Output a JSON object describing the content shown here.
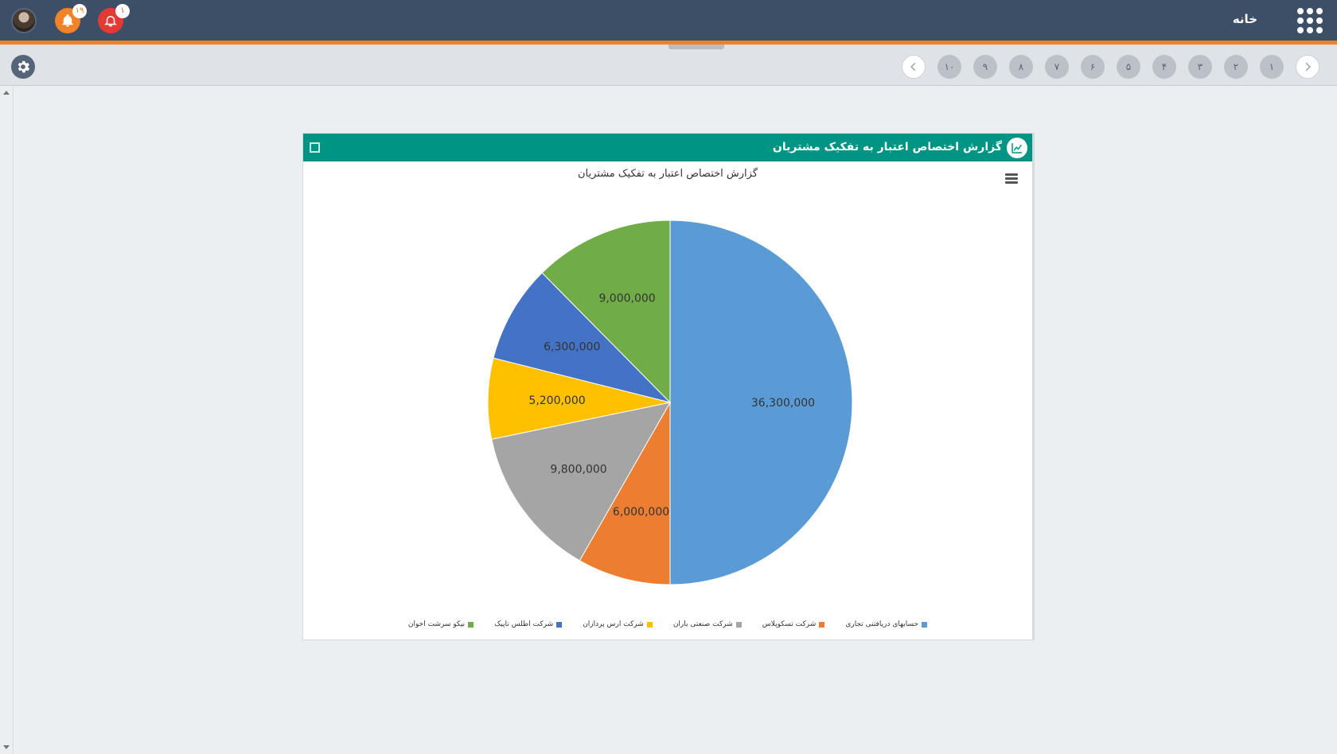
{
  "topbar": {
    "home_label": "خانه",
    "notifications": {
      "count": "۱۹"
    },
    "alerts": {
      "count": "۱"
    }
  },
  "tabs": {
    "pages": [
      "۱",
      "۲",
      "۳",
      "۴",
      "۵",
      "۶",
      "۷",
      "۸",
      "۹",
      "۱۰"
    ]
  },
  "panel": {
    "title": "گزارش اختصاص اعتبار به تفکیک مشتریان"
  },
  "chart_data": {
    "type": "pie",
    "title": "گزارش اختصاص اعتبار به تفکیک مشتریان",
    "legend_placement": "bottom",
    "slices": [
      {
        "name": "حسابهای دریافتنی تجاری",
        "value": 36300000,
        "label": "36,300,000",
        "color": "#5b9bd5"
      },
      {
        "name": "شرکت تسکوپلاس",
        "value": 6000000,
        "label": "6,000,000",
        "color": "#ed7d31"
      },
      {
        "name": "شرکت صنعتی باران",
        "value": 9800000,
        "label": "9,800,000",
        "color": "#a5a5a5"
      },
      {
        "name": "شرکت ارس پردازان",
        "value": 5200000,
        "label": "5,200,000",
        "color": "#ffc000"
      },
      {
        "name": "شرکت اطلس تاپیک",
        "value": 6300000,
        "label": "6,300,000",
        "color": "#4472c4"
      },
      {
        "name": "نیکو سرشت اخوان",
        "value": 9000000,
        "label": "9,000,000",
        "color": "#70ad47"
      }
    ]
  }
}
